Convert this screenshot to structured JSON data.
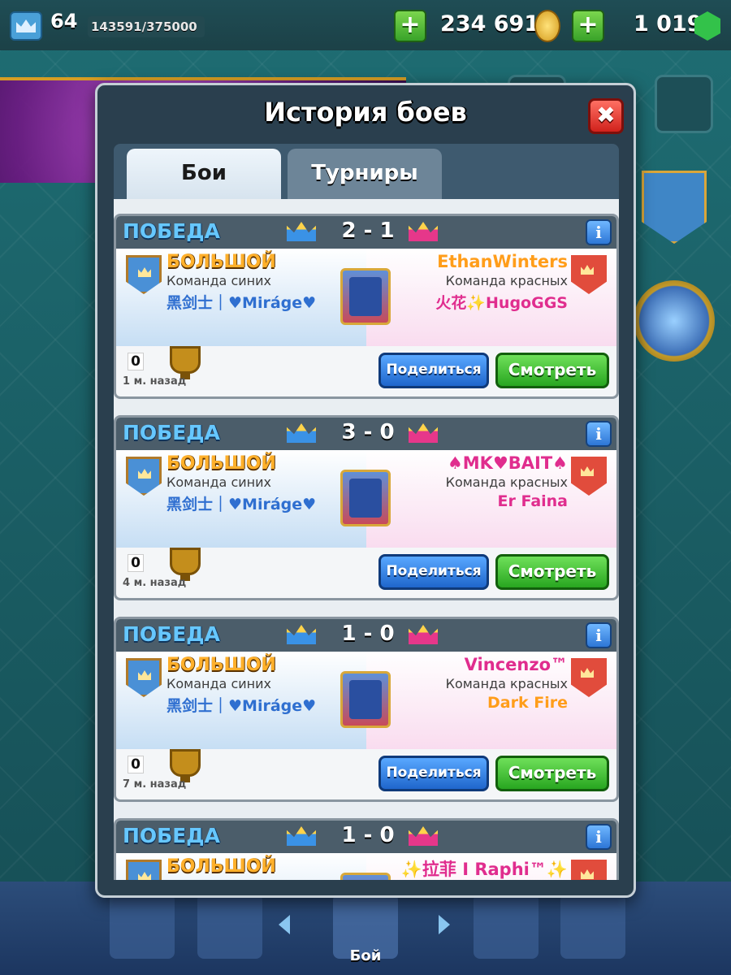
{
  "topbar": {
    "level": "64",
    "xp": "143591/375000",
    "plus_label": "+",
    "gold": "234 691",
    "gems": "1 019",
    "icons": [
      "level-crown-icon",
      "gold-coin-icon",
      "gem-icon"
    ]
  },
  "modal": {
    "title": "История боев",
    "close_label": "✖",
    "tabs": [
      {
        "label": "Бои",
        "active": true
      },
      {
        "label": "Турниры",
        "active": false
      }
    ]
  },
  "battles": [
    {
      "result": "ПОБЕДА",
      "score": "2 - 1",
      "mode": "БОЛЬШОЙ",
      "blue_team_label": "Команда синих",
      "blue_player": "黑剑士｜♥Miráge♥",
      "opponent": "EthanWinters",
      "opponent_color": "#ff9d1a",
      "red_team_label": "Команда красных",
      "red_player": "火花✨HugoGGS",
      "red_player_color": "#e02d8e",
      "trophies": "0",
      "time": "1 м. назад",
      "share_label": "Поделиться",
      "watch_label": "Смотреть"
    },
    {
      "result": "ПОБЕДА",
      "score": "3 - 0",
      "mode": "БОЛЬШОЙ",
      "blue_team_label": "Команда синих",
      "blue_player": "黑剑士｜♥Miráge♥",
      "opponent": "♠MK♥BAIT♠",
      "opponent_color": "#e02d8e",
      "red_team_label": "Команда красных",
      "red_player": "Er Faina",
      "red_player_color": "#e02d8e",
      "trophies": "0",
      "time": "4 м. назад",
      "share_label": "Поделиться",
      "watch_label": "Смотреть"
    },
    {
      "result": "ПОБЕДА",
      "score": "1 - 0",
      "mode": "БОЛЬШОЙ",
      "blue_team_label": "Команда синих",
      "blue_player": "黑剑士｜♥Miráge♥",
      "opponent": "Vincenzo™",
      "opponent_color": "#e02d8e",
      "red_team_label": "Команда красных",
      "red_player": "Dark Fire",
      "red_player_color": "#ff9d1a",
      "trophies": "0",
      "time": "7 м. назад",
      "share_label": "Поделиться",
      "watch_label": "Смотреть"
    },
    {
      "result": "ПОБЕДА",
      "score": "1 - 0",
      "mode": "БОЛЬШОЙ",
      "blue_team_label": "",
      "blue_player": "",
      "opponent": "✨拉菲 I Raphi™✨",
      "opponent_color": "#e02d8e",
      "red_team_label": "",
      "red_player": "",
      "red_player_color": "#e02d8e",
      "trophies": "",
      "time": "",
      "share_label": "",
      "watch_label": ""
    }
  ],
  "bottom_nav": {
    "active_label": "Бой"
  }
}
